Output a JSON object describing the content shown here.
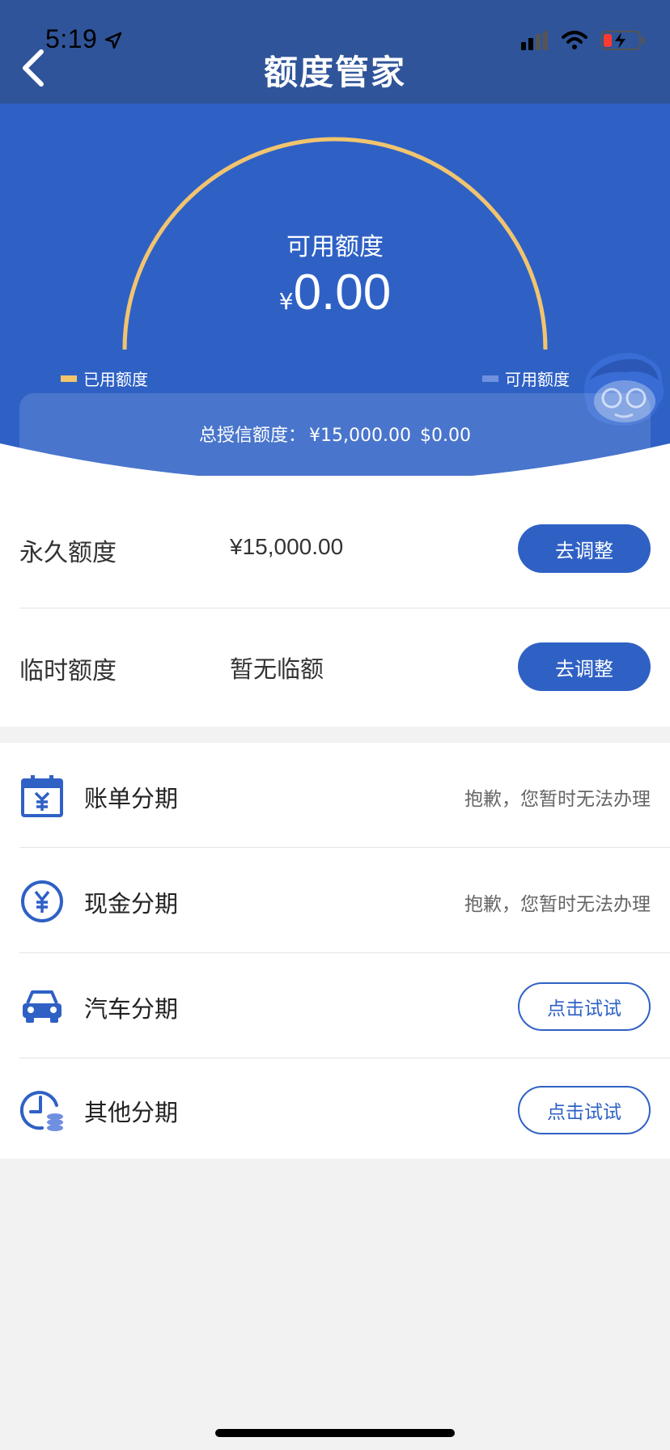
{
  "status_bar": {
    "time": "5:19"
  },
  "header": {
    "title": "额度管家"
  },
  "gauge": {
    "label": "可用额度",
    "currency": "¥",
    "amount": "0.00",
    "used_fraction": 1.0,
    "legend": [
      {
        "label": "已用额度",
        "color": "#f2c46d"
      },
      {
        "label": "可用额度",
        "color": "#6f90e0"
      }
    ]
  },
  "total": {
    "label": "总授信额度：",
    "cny": "¥15,000.00",
    "usd": "$0.00"
  },
  "credit_rows": [
    {
      "label": "永久额度",
      "value": "¥15,000.00",
      "button": "去调整"
    },
    {
      "label": "临时额度",
      "value": "暂无临额",
      "button": "去调整"
    }
  ],
  "installments": [
    {
      "label": "账单分期",
      "icon": "calendar-yen-icon",
      "status": "抱歉，您暂时无法办理"
    },
    {
      "label": "现金分期",
      "icon": "yen-circle-icon",
      "status": "抱歉，您暂时无法办理"
    },
    {
      "label": "汽车分期",
      "icon": "car-icon",
      "button": "点击试试"
    },
    {
      "label": "其他分期",
      "icon": "clock-coins-icon",
      "button": "点击试试"
    }
  ],
  "colors": {
    "nav_bg": "#2f5499",
    "hero_bg": "#2f61c5",
    "accent": "#2f61c5",
    "gauge_used": "#f2c46d"
  }
}
